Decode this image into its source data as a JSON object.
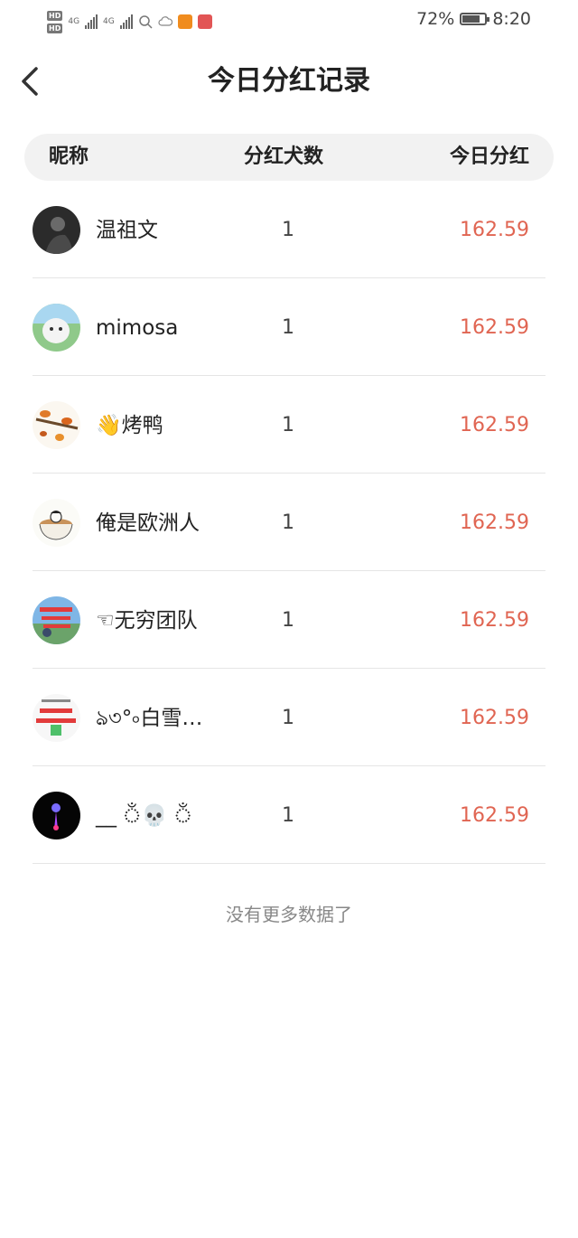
{
  "status_bar": {
    "network": "4G",
    "battery": "72%",
    "time": "8:20"
  },
  "header": {
    "title": "今日分红记录"
  },
  "table": {
    "columns": [
      "昵称",
      "分红犬数",
      "今日分红"
    ],
    "rows": [
      {
        "nickname": "温祖文",
        "count": "1",
        "amount": "162.59"
      },
      {
        "nickname": "mimosa",
        "count": "1",
        "amount": "162.59"
      },
      {
        "nickname": "👋烤鸭",
        "count": "1",
        "amount": "162.59"
      },
      {
        "nickname": "俺是欧洲人",
        "count": "1",
        "amount": "162.59"
      },
      {
        "nickname": "☜无穷团队",
        "count": "1",
        "amount": "162.59"
      },
      {
        "nickname": "ঌ৩°৹白雪…",
        "count": "1",
        "amount": "162.59"
      },
      {
        "nickname": "__ ঁ💀 ঁ",
        "count": "1",
        "amount": "162.59"
      }
    ]
  },
  "footer": {
    "no_more": "没有更多数据了"
  },
  "colors": {
    "amount": "#e06552",
    "header_bg": "#f2f2f2"
  }
}
